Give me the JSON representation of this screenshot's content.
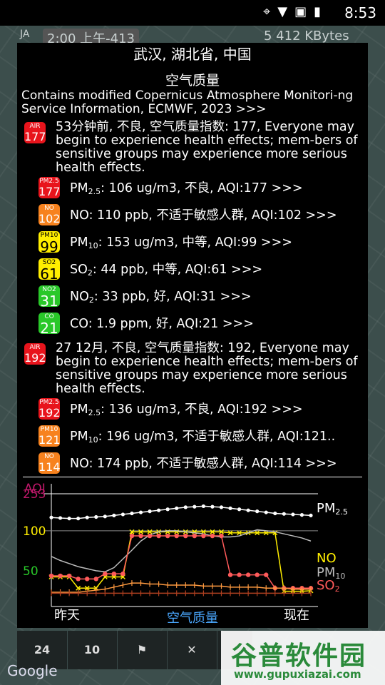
{
  "status": {
    "time": "8:53"
  },
  "map": {
    "ja": "JA",
    "clock": "2:00 上午-413",
    "kbytes": "5 412 KBytes",
    "google": "Google"
  },
  "dialog": {
    "title": "武汉, 湖北省, 中国",
    "subtitle": "空气质量",
    "source": "Contains modified Copernicus Atmosphere Monitori-ng Service Information, ECMWF, 2023 >>>",
    "current": {
      "badge": {
        "label": "AIR",
        "value": "177"
      },
      "text": "53分钟前, 不良, 空气质量指数: 177, Everyone may begin to experience health effects; mem-bers of sensitive groups may experience more serious health effects.",
      "rows": [
        {
          "label": "PM2.5",
          "value": "177",
          "color": "#e8141c",
          "name": "PM",
          "sub": "2.5",
          "text": ": 106 ug/m3, 不良, AQI:177 >>>"
        },
        {
          "label": "NO",
          "value": "102",
          "color": "#f7821e",
          "name": "NO",
          "sub": "",
          "text": ": 110 ppb, 不适于敏感人群, AQI:102 >>>"
        },
        {
          "label": "PM10",
          "value": "99",
          "color": "#ffee00",
          "name": "PM",
          "sub": "10",
          "text": ": 153 ug/m3, 中等, AQI:99 >>>"
        },
        {
          "label": "SO2",
          "value": "61",
          "color": "#ffee00",
          "name": "SO",
          "sub": "2",
          "text": ": 44 ppb, 中等, AQI:61 >>>"
        },
        {
          "label": "NO2",
          "value": "31",
          "color": "#29c829",
          "name": "NO",
          "sub": "2",
          "text": ": 33 ppb, 好, AQI:31 >>>"
        },
        {
          "label": "CO",
          "value": "21",
          "color": "#29c829",
          "name": "CO",
          "sub": "",
          "text": ": 1.9 ppm, 好, AQI:21 >>>"
        }
      ]
    },
    "forecast": {
      "badge": {
        "label": "AIR",
        "value": "192"
      },
      "text": "27 12月, 不良, 空气质量指数: 192, Everyone may begin to experience health effects; mem-bers of sensitive groups may experience more serious health effects.",
      "rows": [
        {
          "label": "PM2.5",
          "value": "192",
          "color": "#e8141c",
          "name": "PM",
          "sub": "2.5",
          "text": ": 136 ug/m3, 不良, AQI:192 >>>"
        },
        {
          "label": "PM10",
          "value": "121",
          "color": "#f7821e",
          "name": "PM",
          "sub": "10",
          "text": ": 196 ug/m3, 不适于敏感人群, AQI:121.."
        },
        {
          "label": "NO",
          "value": "114",
          "color": "#f7821e",
          "name": "NO",
          "sub": "",
          "text": ": 174 ppb, 不适于敏感人群, AQI:114 >>>"
        }
      ]
    }
  },
  "chart_data": {
    "type": "line",
    "ylabel": "AQI",
    "yticks": [
      "253",
      "100",
      "50"
    ],
    "xlabel_left": "昨天",
    "xlabel_center": "空气质量",
    "xlabel_right": "现在",
    "series": [
      {
        "name": "PM2.5",
        "nameMain": "PM",
        "nameSub": "2.5",
        "color": "#ffffff",
        "values": [
          176,
          175,
          174,
          174,
          176,
          177,
          178,
          180,
          182,
          184,
          186,
          188,
          190,
          192,
          194,
          196,
          197,
          198,
          197,
          196,
          194,
          192,
          190,
          188,
          186,
          184,
          183,
          182,
          181,
          180
        ]
      },
      {
        "name": "NO",
        "nameMain": "NO",
        "nameSub": "",
        "color": "#ffee00",
        "values": [
          60,
          60,
          60,
          38,
          38,
          38,
          60,
          60,
          60,
          148,
          148,
          148,
          148,
          148,
          148,
          148,
          148,
          148,
          148,
          148,
          146,
          146,
          146,
          146,
          146,
          146,
          32,
          32,
          32,
          33
        ]
      },
      {
        "name": "PM10",
        "nameMain": "PM",
        "nameSub": "10",
        "color": "#bbbbbb",
        "values": [
          100,
          92,
          86,
          80,
          76,
          72,
          70,
          78,
          95,
          112,
          130,
          142,
          148,
          150,
          150,
          148,
          146,
          144,
          140,
          138,
          138,
          140,
          146,
          152,
          150,
          148,
          144,
          140,
          136,
          130
        ]
      },
      {
        "name": "SO2",
        "nameMain": "SO",
        "nameSub": "2",
        "color": "#ff5a5a",
        "values": [
          62,
          62,
          62,
          56,
          56,
          56,
          66,
          66,
          66,
          140,
          140,
          140,
          140,
          140,
          140,
          140,
          140,
          140,
          140,
          140,
          64,
          64,
          64,
          64,
          64,
          38,
          38,
          38,
          38,
          38
        ]
      },
      {
        "name": "",
        "nameMain": "",
        "nameSub": "",
        "color": "#ff9a40",
        "values": [
          30,
          30,
          30,
          30,
          32,
          34,
          36,
          40,
          44,
          48,
          48,
          46,
          46,
          44,
          44,
          44,
          44,
          42,
          42,
          42,
          40,
          40,
          40,
          40,
          38,
          38,
          38,
          36,
          36,
          36
        ]
      },
      {
        "name": "",
        "nameMain": "",
        "nameSub": "",
        "color": "#b04020",
        "values": [
          28,
          28,
          28,
          28,
          28,
          28,
          28,
          28,
          28,
          28,
          28,
          28,
          28,
          28,
          28,
          28,
          28,
          28,
          28,
          28,
          28,
          28,
          28,
          28,
          28,
          28,
          28,
          28,
          28,
          28
        ]
      }
    ]
  },
  "bottombar": {
    "b1": "24",
    "b2": "10"
  },
  "watermark": {
    "big": "谷普软件园",
    "url": "www.gupuxiazai.com"
  }
}
